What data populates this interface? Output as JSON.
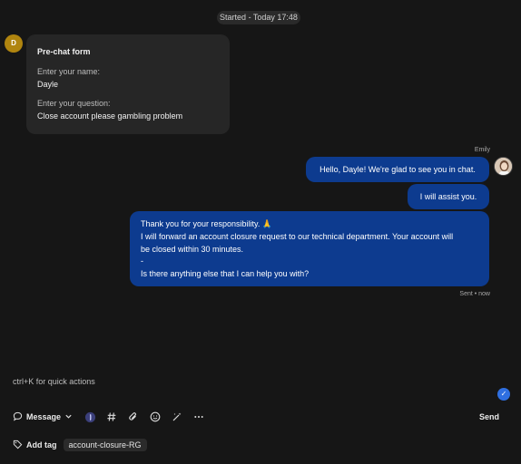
{
  "session": {
    "started_label": "Started - Today 17:48"
  },
  "customer": {
    "initial": "D"
  },
  "prechat": {
    "title": "Pre-chat form",
    "fields": [
      {
        "label": "Enter your name:",
        "value": "Dayle"
      },
      {
        "label": "Enter your question:",
        "value": "Close account please gambling problem"
      }
    ]
  },
  "agent": {
    "name": "Emily"
  },
  "messages": [
    {
      "text": "Hello, Dayle! We're glad to see you in chat."
    },
    {
      "text": "I will assist you."
    },
    {
      "lines": [
        "Thank you for your responsibility. 🙏",
        "I will forward an account closure request to our technical department. Your account will",
        "be closed within 30 minutes.",
        "-",
        "Is there anything else that I can help you with?"
      ]
    }
  ],
  "status": {
    "sent": "Sent • now"
  },
  "composer": {
    "hint": "ctrl+K for quick actions",
    "mode_label": "Message",
    "send_label": "Send",
    "add_tag_label": "Add tag",
    "tags": [
      "account-closure-RG"
    ],
    "accent": "#2f6fe0",
    "bubble_color": "#0d3b8f"
  }
}
